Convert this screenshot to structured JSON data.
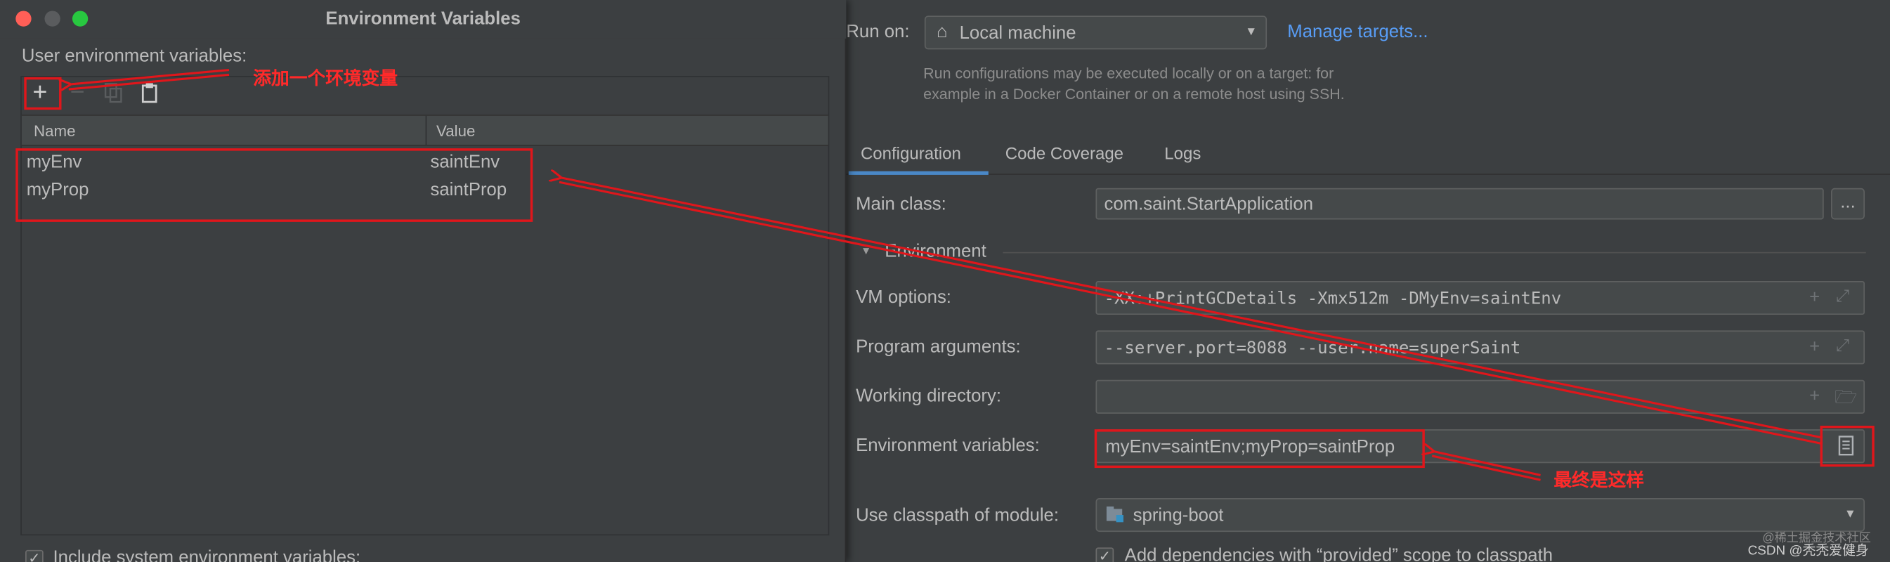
{
  "run_on": {
    "label": "Run on:",
    "target_value": "Local machine",
    "manage_link": "Manage targets...",
    "hint_line1": "Run configurations may be executed locally or on a target: for",
    "hint_line2": "example in a Docker Container or on a remote host using SSH."
  },
  "tabs": [
    {
      "label": "Configuration",
      "active": true
    },
    {
      "label": "Code Coverage",
      "active": false
    },
    {
      "label": "Logs",
      "active": false
    }
  ],
  "form": {
    "main_class_label": "Main class:",
    "main_class_value": "com.saint.StartApplication",
    "browse_label": "...",
    "environment_section": "Environment",
    "vm_options_label": "VM options:",
    "vm_options_value": "-XX:+PrintGCDetails -Xmx512m -DMyEnv=saintEnv",
    "program_args_label": "Program arguments:",
    "program_args_value": "--server.port=8088 --user.name=superSaint",
    "working_dir_label": "Working directory:",
    "working_dir_value": "",
    "env_vars_label": "Environment variables:",
    "env_vars_value": "myEnv=saintEnv;myProp=saintProp",
    "classpath_label": "Use classpath of module:",
    "classpath_value": "spring-boot",
    "provided_scope_label": "Add dependencies with “provided” scope to classpath"
  },
  "dialog": {
    "title": "Environment Variables",
    "section_label": "User environment variables:",
    "columns": [
      "Name",
      "Value"
    ],
    "rows": [
      {
        "name": "myEnv",
        "value": "saintEnv"
      },
      {
        "name": "myProp",
        "value": "saintProp"
      }
    ],
    "include_system_label": "Include system environment variables:"
  },
  "annotations": {
    "add_note": "添加一个环境变量",
    "final_note": "最终是这样"
  },
  "watermark": {
    "line1": "@稀土掘金技术社区",
    "line2": "CSDN @秃秃爱健身"
  },
  "colors": {
    "background": "#3c3f41",
    "field_background": "#45494a",
    "link": "#589df6",
    "tab_underline": "#4a88c7",
    "annotation_red": "#e0161b",
    "traffic_close": "#ff5f57",
    "traffic_min": "#5a5c5e",
    "traffic_max": "#28c840"
  }
}
